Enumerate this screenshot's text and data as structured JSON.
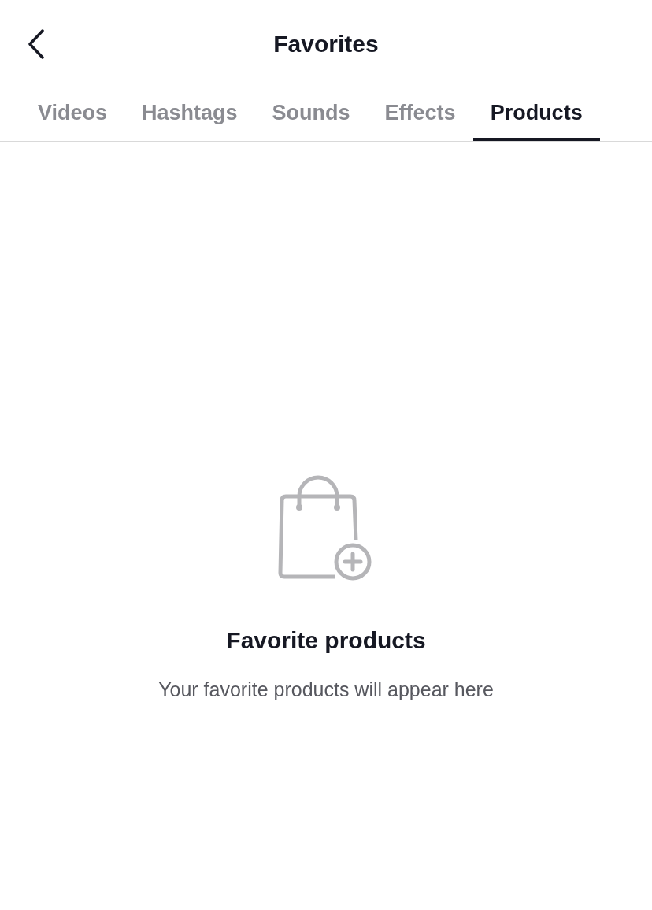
{
  "header": {
    "title": "Favorites"
  },
  "tabs": [
    {
      "label": "Videos",
      "selected": false
    },
    {
      "label": "Hashtags",
      "selected": false
    },
    {
      "label": "Sounds",
      "selected": false
    },
    {
      "label": "Effects",
      "selected": false
    },
    {
      "label": "Products",
      "selected": true
    }
  ],
  "empty_state": {
    "title": "Favorite products",
    "message": "Your favorite products will appear here"
  }
}
